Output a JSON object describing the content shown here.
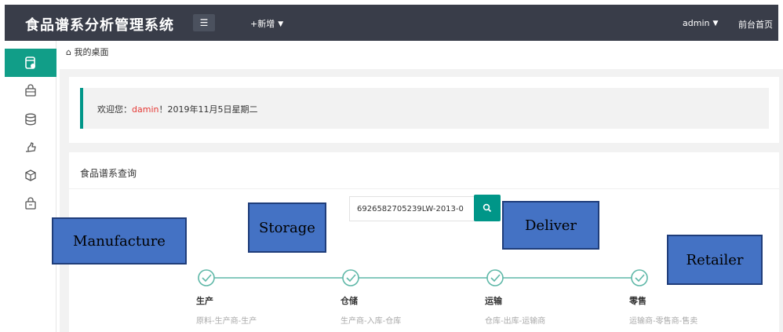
{
  "header": {
    "app_title": "食品谱系分析管理系统",
    "menu_toggle_icon": "menu-icon",
    "add_label": "+新增",
    "user_label": "admin",
    "home_label": "前台首页"
  },
  "sidebar": {
    "items": [
      {
        "icon": "document-icon",
        "active": true
      },
      {
        "icon": "bag-icon",
        "active": false
      },
      {
        "icon": "database-icon",
        "active": false
      },
      {
        "icon": "hand-icon",
        "active": false
      },
      {
        "icon": "cube-icon",
        "active": false
      },
      {
        "icon": "bag-icon",
        "active": false
      }
    ],
    "accent_color": "#119e88"
  },
  "breadcrumb": {
    "icon": "home-icon",
    "label": "我的桌面"
  },
  "welcome": {
    "prefix": "欢迎您：",
    "username": "damin",
    "suffix": "！2019年11月5日星期二"
  },
  "query": {
    "title": "食品谱系查询",
    "search_value": "6926582705239LW-2013-0",
    "search_icon": "search-icon"
  },
  "timeline": {
    "steps": [
      {
        "title": "生产",
        "desc": "原料-生产商-生产"
      },
      {
        "title": "仓储",
        "desc": "生产商-入库-仓库"
      },
      {
        "title": "运输",
        "desc": "仓库-出库-运输商"
      },
      {
        "title": "零售",
        "desc": "运输商-零售商-售卖"
      }
    ],
    "line_color": "#5fb8a8"
  },
  "annotations": {
    "manufacture": "Manufacture",
    "storage": "Storage",
    "deliver": "Deliver",
    "retailer": "Retailer",
    "box_color": "#4472c4"
  }
}
